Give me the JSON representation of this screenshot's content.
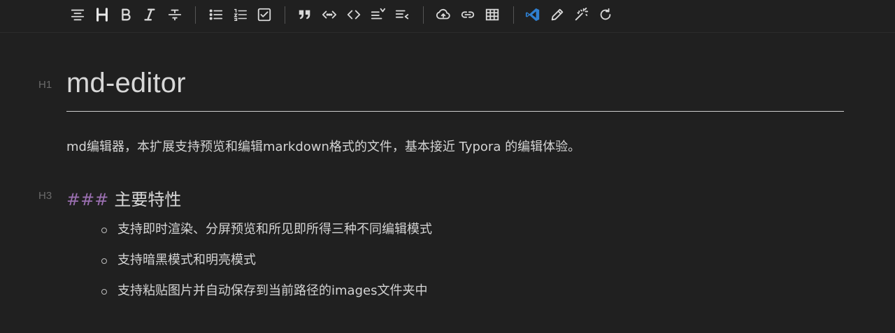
{
  "toolbar": {
    "buttons": [
      {
        "name": "align-center-icon"
      },
      {
        "name": "heading-icon"
      },
      {
        "name": "bold-icon"
      },
      {
        "name": "italic-icon"
      },
      {
        "name": "strikethrough-icon"
      },
      {
        "name": "bullet-list-icon"
      },
      {
        "name": "ordered-list-icon"
      },
      {
        "name": "task-list-icon"
      },
      {
        "name": "quote-icon"
      },
      {
        "name": "inline-code-icon"
      },
      {
        "name": "code-block-icon"
      },
      {
        "name": "indent-icon"
      },
      {
        "name": "outdent-icon"
      },
      {
        "name": "upload-cloud-icon"
      },
      {
        "name": "link-icon"
      },
      {
        "name": "table-icon"
      },
      {
        "name": "vscode-icon"
      },
      {
        "name": "edit-pencil-icon"
      },
      {
        "name": "magic-wand-icon"
      },
      {
        "name": "refresh-icon"
      }
    ],
    "accent": "#3c8fd9",
    "icon_color": "#d8d8d8"
  },
  "document": {
    "h1_level": "H1",
    "h1_text": "md-editor",
    "paragraph": "md编辑器，本扩展支持预览和编辑markdown格式的文件，基本接近 Typora 的编辑体验。",
    "h3_level": "H3",
    "h3_mark": "###",
    "h3_text": "主要特性",
    "features": [
      "支持即时渲染、分屏预览和所见即所得三种不同编辑模式",
      "支持暗黑模式和明亮模式",
      "支持粘贴图片并自动保存到当前路径的images文件夹中"
    ]
  }
}
